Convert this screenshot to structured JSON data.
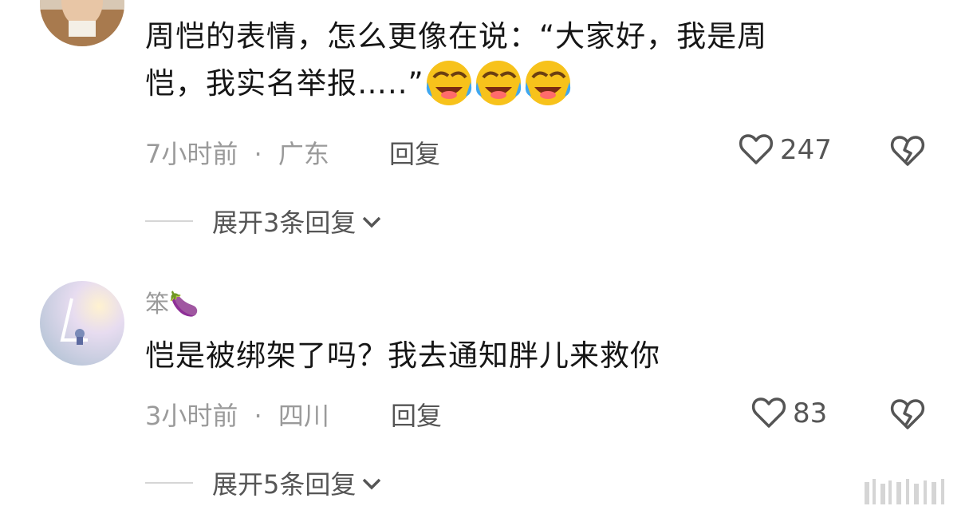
{
  "comments": [
    {
      "username": "",
      "text_line1": "周恺的表情，怎么更像在说：“大家好，我是周",
      "text_line2": "恺，我实名举报…..”",
      "emojis": [
        "rofl-emoji",
        "rofl-emoji",
        "rofl-emoji"
      ],
      "time": "7小时前",
      "separator": "·",
      "location": "广东",
      "reply_label": "回复",
      "likes": "247",
      "expand_label": "展开3条回复"
    },
    {
      "username": "笨🍆",
      "text_line1": "恺是被绑架了吗？我去通知胖儿来救你",
      "time": "3小时前",
      "separator": "·",
      "location": "四川",
      "reply_label": "回复",
      "likes": "83",
      "expand_label": "展开5条回复"
    }
  ],
  "watermark": "头条 @",
  "colors": {
    "text": "#161616",
    "meta": "#9a9a9a",
    "secondary": "#555555",
    "emoji_yellow": "#f7c21b",
    "emoji_tear": "#3fa7f0"
  }
}
